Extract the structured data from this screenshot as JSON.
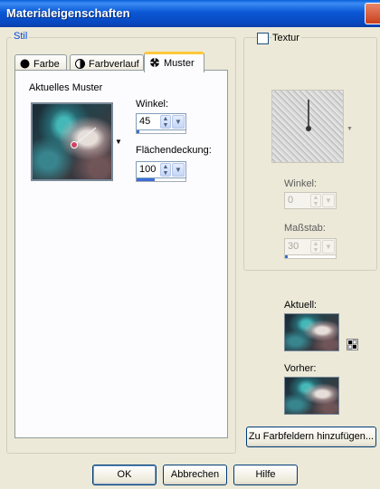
{
  "window": {
    "title": "Materialeigenschaften"
  },
  "stil": {
    "legend": "Stil",
    "tabs": [
      {
        "label": "Farbe",
        "icon": "circle-fill-icon"
      },
      {
        "label": "Farbverlauf",
        "icon": "half-circle-icon"
      },
      {
        "label": "Muster",
        "icon": "pattern-crosshair-icon",
        "active": true
      }
    ],
    "current_pattern_label": "Aktuelles Muster",
    "angle": {
      "label": "Winkel:",
      "value": "45",
      "slider_fraction": 0.06
    },
    "coverage": {
      "label": "Flächendeckung:",
      "value": "100",
      "slider_fraction": 0.37
    }
  },
  "texture": {
    "checkbox_label": "Textur",
    "checked": false,
    "angle": {
      "label": "Winkel:",
      "value": "0"
    },
    "scale": {
      "label": "Maßstab:",
      "value": "30",
      "slider_fraction": 0.05
    }
  },
  "preview": {
    "current_label": "Aktuell:",
    "previous_label": "Vorher:",
    "add_to_swatches_label": "Zu Farbfeldern hinzufügen..."
  },
  "footer": {
    "ok_label": "OK",
    "cancel_label": "Abbrechen",
    "help_label": "Hilfe"
  },
  "colors": {
    "title_bar": "#0b58d6",
    "dialog_bg": "#ece9d8",
    "legend_text": "#0046d5",
    "active_tab_accent": "#ffc83c",
    "slider_fill": "#3c6ed8"
  }
}
